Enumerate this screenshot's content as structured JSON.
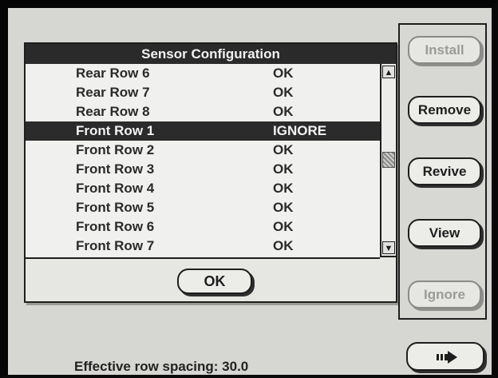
{
  "dialog": {
    "title": "Sensor Configuration",
    "rows": [
      {
        "name": "Rear Row 6",
        "status": "OK",
        "selected": false
      },
      {
        "name": "Rear Row 7",
        "status": "OK",
        "selected": false
      },
      {
        "name": "Rear Row 8",
        "status": "OK",
        "selected": false
      },
      {
        "name": "Front Row 1",
        "status": "IGNORE",
        "selected": true
      },
      {
        "name": "Front Row 2",
        "status": "OK",
        "selected": false
      },
      {
        "name": "Front Row 3",
        "status": "OK",
        "selected": false
      },
      {
        "name": "Front Row 4",
        "status": "OK",
        "selected": false
      },
      {
        "name": "Front Row 5",
        "status": "OK",
        "selected": false
      },
      {
        "name": "Front Row 6",
        "status": "OK",
        "selected": false
      },
      {
        "name": "Front Row 7",
        "status": "OK",
        "selected": false
      }
    ],
    "ok_label": "OK",
    "scroll_up_icon": "arrow-up-icon",
    "scroll_down_icon": "arrow-down-icon"
  },
  "side": {
    "install_label": "Install",
    "install_enabled": false,
    "remove_label": "Remove",
    "revive_label": "Revive",
    "view_label": "View",
    "ignore_label": "Ignore",
    "ignore_enabled": false,
    "next_icon": "next-arrow-icon"
  },
  "footer": {
    "text": "Effective row spacing: 30.0"
  }
}
